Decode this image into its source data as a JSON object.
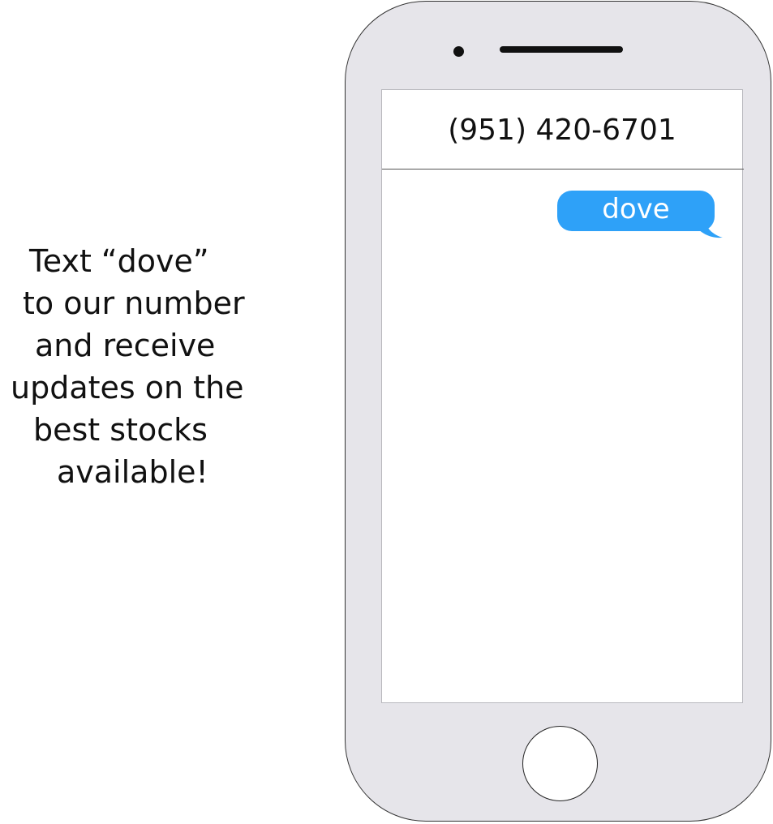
{
  "promo": {
    "lines": [
      "Text “dove”",
      "to our number",
      "and receive",
      "updates on the",
      "best stocks",
      "available!"
    ]
  },
  "phone": {
    "header": {
      "contact_number": "(951) 420-6701"
    },
    "messages": [
      {
        "text": "dove",
        "direction": "sent"
      }
    ],
    "colors": {
      "bezel": "#e6e5ea",
      "sent_bubble": "#2ea1f8",
      "bubble_text": "#ffffff"
    }
  }
}
